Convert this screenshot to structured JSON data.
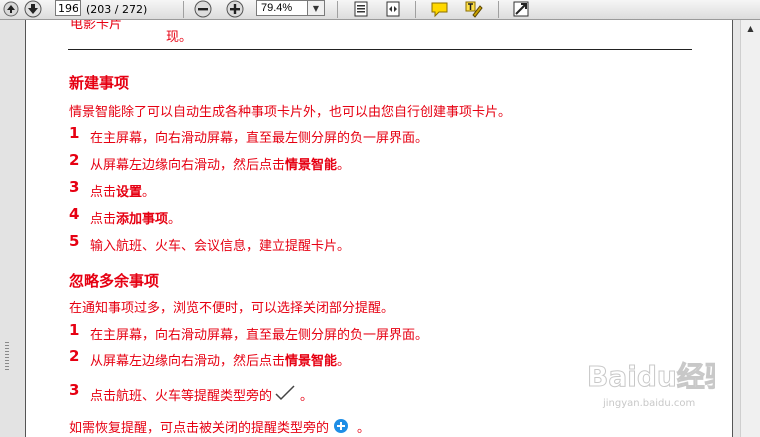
{
  "toolbar": {
    "page_number": "196",
    "page_count": "(203 / 272)",
    "zoom_level": "79.4%"
  },
  "document": {
    "top_fragment": "电影卡片",
    "top_fragment2": "现。",
    "section1": {
      "heading": "新建事项",
      "intro": "情景智能除了可以自动生成各种事项卡片外，也可以由您自行创建事项卡片。",
      "steps": [
        {
          "num": "1",
          "text": "在主屏幕，向右滑动屏幕，直至最左侧分屏的负一屏界面。"
        },
        {
          "num": "2",
          "text": "从屏幕左边缘向右滑动，然后点击",
          "bold": "情景智能",
          "end": "。"
        },
        {
          "num": "3",
          "text": "点击",
          "bold": "设置",
          "end": "。"
        },
        {
          "num": "4",
          "text": "点击",
          "bold": "添加事项",
          "end": "。"
        },
        {
          "num": "5",
          "text": "输入航班、火车、会议信息，建立提醒卡片。"
        }
      ]
    },
    "section2": {
      "heading": "忽略多余事项",
      "intro": "在通知事项过多，浏览不便时，可以选择关闭部分提醒。",
      "steps": [
        {
          "num": "1",
          "text": "在主屏幕，向右滑动屏幕，直至最左侧分屏的负一屏界面。"
        },
        {
          "num": "2",
          "text": "从屏幕左边缘向右滑动，然后点击",
          "bold": "情景智能",
          "end": "。"
        },
        {
          "num": "3",
          "text": "点击航班、火车等提醒类型旁的",
          "end": "。"
        }
      ],
      "restore_pre": "如需恢复提醒，可点击被关闭的提醒类型旁的",
      "restore_end": "。"
    }
  },
  "watermark": {
    "brand": "Baidu经验",
    "url": "jingyan.baidu.com"
  },
  "colors": {
    "doc_text": "#e60012",
    "plus_icon": "#1e8ee6"
  }
}
